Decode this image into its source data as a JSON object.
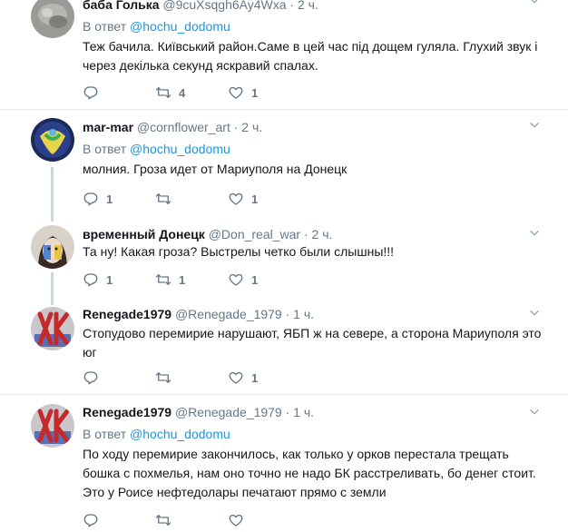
{
  "tweets": [
    {
      "name": "баба Голька",
      "handle": "@9cuXsqgh6Ay4Wxa",
      "dot": "·",
      "time": "2 ч.",
      "reply_prefix": "В ответ",
      "reply_user": "@hochu_dodomu",
      "text_lines": [
        "Теж бачила. Київський район.Саме в цей час під дощем гуляла. Глухий звук і",
        "через декілька секунд яскравий спалах."
      ],
      "replies": "",
      "retweets": "4",
      "likes": "1"
    },
    {
      "name": "mar-mar",
      "handle": "@cornflower_art",
      "dot": "·",
      "time": "2 ч.",
      "reply_prefix": "В ответ",
      "reply_user": "@hochu_dodomu",
      "text_lines": [
        "молния. Гроза идет от Мариуполя на Донецк"
      ],
      "replies": "1",
      "retweets": "",
      "likes": "1"
    },
    {
      "name": "временный Донецк",
      "handle": "@Don_real_war",
      "dot": "·",
      "time": "2 ч.",
      "text_lines": [
        "Та ну! Какая гроза? Выстрелы четко были слышны!!!"
      ],
      "replies": "1",
      "retweets": "1",
      "likes": "1"
    },
    {
      "name": "Renegade1979",
      "handle": "@Renegade_1979",
      "dot": "·",
      "time": "1 ч.",
      "text_lines": [
        "Стопудово перемирие нарушают, ЯБП ж на севере, а сторона Мариуполя это",
        "юг"
      ],
      "replies": "",
      "retweets": "",
      "likes": "1"
    },
    {
      "name": "Renegade1979",
      "handle": "@Renegade_1979",
      "dot": "·",
      "time": "1 ч.",
      "reply_prefix": "В ответ",
      "reply_user": "@hochu_dodomu",
      "text_lines": [
        "По ходу перемирие закончилось, как только у орков перестала трещать",
        "бошка с похмелья, нам оно точно не надо БК расстреливать, бо денег стоит.",
        "Это у Роисе нефтедолары печатают прямо с земли"
      ],
      "replies": "",
      "retweets": "",
      "likes": ""
    }
  ],
  "icons": {
    "reply": "reply-icon",
    "retweet": "retweet-icon",
    "like": "heart-icon",
    "more": "chevron-down-icon"
  },
  "colors": {
    "link": "#1b95e0",
    "muted": "#657786",
    "divider": "#e6ecf0"
  }
}
